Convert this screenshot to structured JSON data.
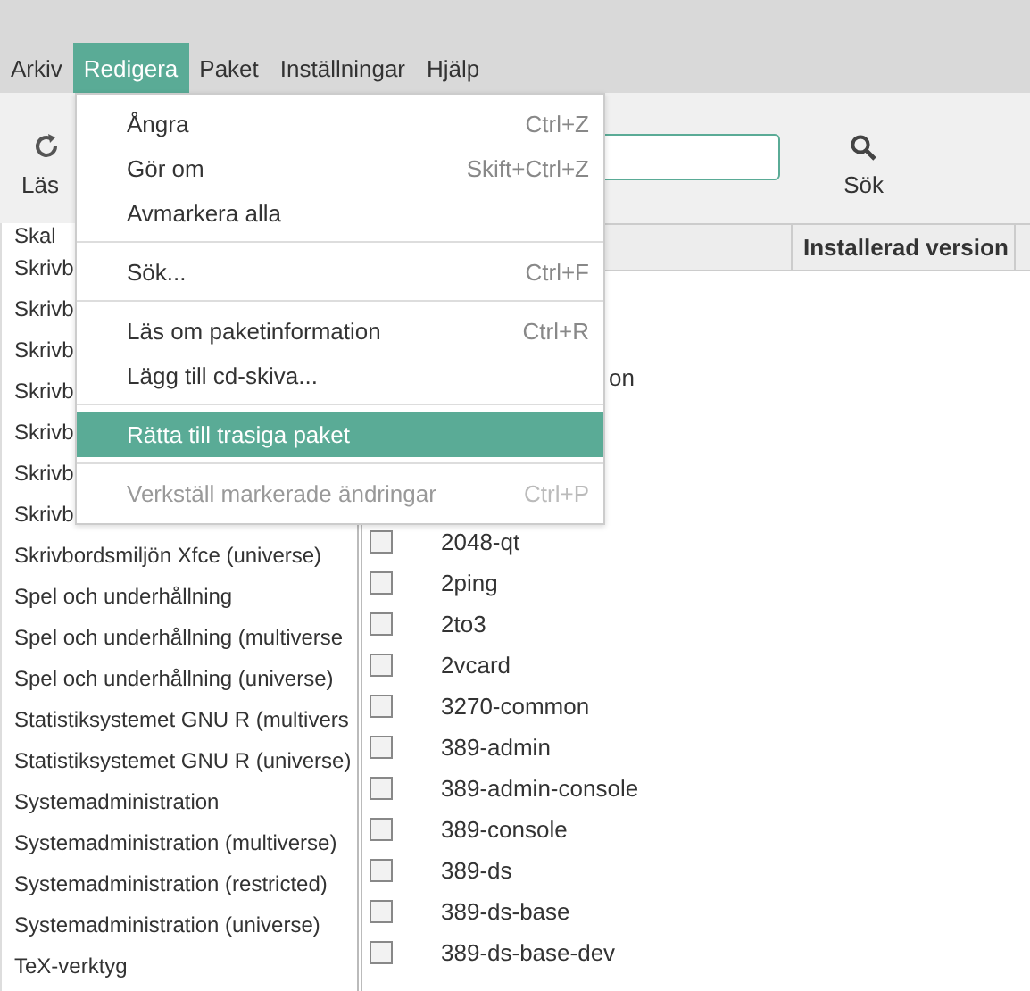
{
  "menubar": [
    {
      "label": "Arkiv",
      "selected": false
    },
    {
      "label": "Redigera",
      "selected": true
    },
    {
      "label": "Paket",
      "selected": false
    },
    {
      "label": "Inställningar",
      "selected": false
    },
    {
      "label": "Hjälp",
      "selected": false
    }
  ],
  "toolbar": {
    "reload": {
      "label": "Läs"
    },
    "search_button": {
      "label": "Sök"
    }
  },
  "categories": [
    {
      "label": "Skal"
    },
    {
      "label": "Skrivb"
    },
    {
      "label": "Skrivb"
    },
    {
      "label": "Skrivb"
    },
    {
      "label": "Skrivb"
    },
    {
      "label": "Skrivb"
    },
    {
      "label": "Skrivb"
    },
    {
      "label": "Skrivb"
    },
    {
      "label": "Skrivbordsmiljön Xfce (universe)"
    },
    {
      "label": "Spel och underhållning"
    },
    {
      "label": "Spel och underhållning (multiverse"
    },
    {
      "label": "Spel och underhållning (universe)"
    },
    {
      "label": "Statistiksystemet GNU R (multivers"
    },
    {
      "label": "Statistiksystemet GNU R (universe)"
    },
    {
      "label": "Systemadministration"
    },
    {
      "label": "Systemadministration (multiverse)"
    },
    {
      "label": "Systemadministration (restricted)"
    },
    {
      "label": "Systemadministration (universe)"
    },
    {
      "label": "TeX-verktyg"
    }
  ],
  "table": {
    "columns": [
      {
        "label": "Installerad version"
      }
    ],
    "rows": [
      {
        "name": "on",
        "partial": true
      },
      {
        "name": "2048-qt",
        "checked": false
      },
      {
        "name": "2ping",
        "checked": false
      },
      {
        "name": "2to3",
        "checked": false
      },
      {
        "name": "2vcard",
        "checked": false
      },
      {
        "name": "3270-common",
        "checked": false
      },
      {
        "name": "389-admin",
        "checked": false
      },
      {
        "name": "389-admin-console",
        "checked": false
      },
      {
        "name": "389-console",
        "checked": false
      },
      {
        "name": "389-ds",
        "checked": false
      },
      {
        "name": "389-ds-base",
        "checked": false
      },
      {
        "name": "389-ds-base-dev",
        "checked": false
      }
    ]
  },
  "menu": [
    {
      "kind": "item",
      "label": "Ångra",
      "shortcut": "Ctrl+Z",
      "selected": false,
      "disabled": false
    },
    {
      "kind": "item",
      "label": "Gör om",
      "shortcut": "Skift+Ctrl+Z",
      "selected": false,
      "disabled": false
    },
    {
      "kind": "item",
      "label": "Avmarkera alla",
      "selected": false,
      "disabled": false
    },
    {
      "kind": "separator"
    },
    {
      "kind": "item",
      "label": "Sök...",
      "shortcut": "Ctrl+F",
      "selected": false,
      "disabled": false
    },
    {
      "kind": "separator"
    },
    {
      "kind": "item",
      "label": "Läs om paketinformation",
      "shortcut": "Ctrl+R",
      "selected": false,
      "disabled": false
    },
    {
      "kind": "item",
      "label": "Lägg till cd-skiva...",
      "selected": false,
      "disabled": false
    },
    {
      "kind": "separator"
    },
    {
      "kind": "item",
      "label": "Rätta till trasiga paket",
      "selected": true,
      "disabled": false
    },
    {
      "kind": "separator"
    },
    {
      "kind": "item",
      "label": "Verkställ markerade ändringar",
      "shortcut": "Ctrl+P",
      "selected": false,
      "disabled": true
    }
  ]
}
